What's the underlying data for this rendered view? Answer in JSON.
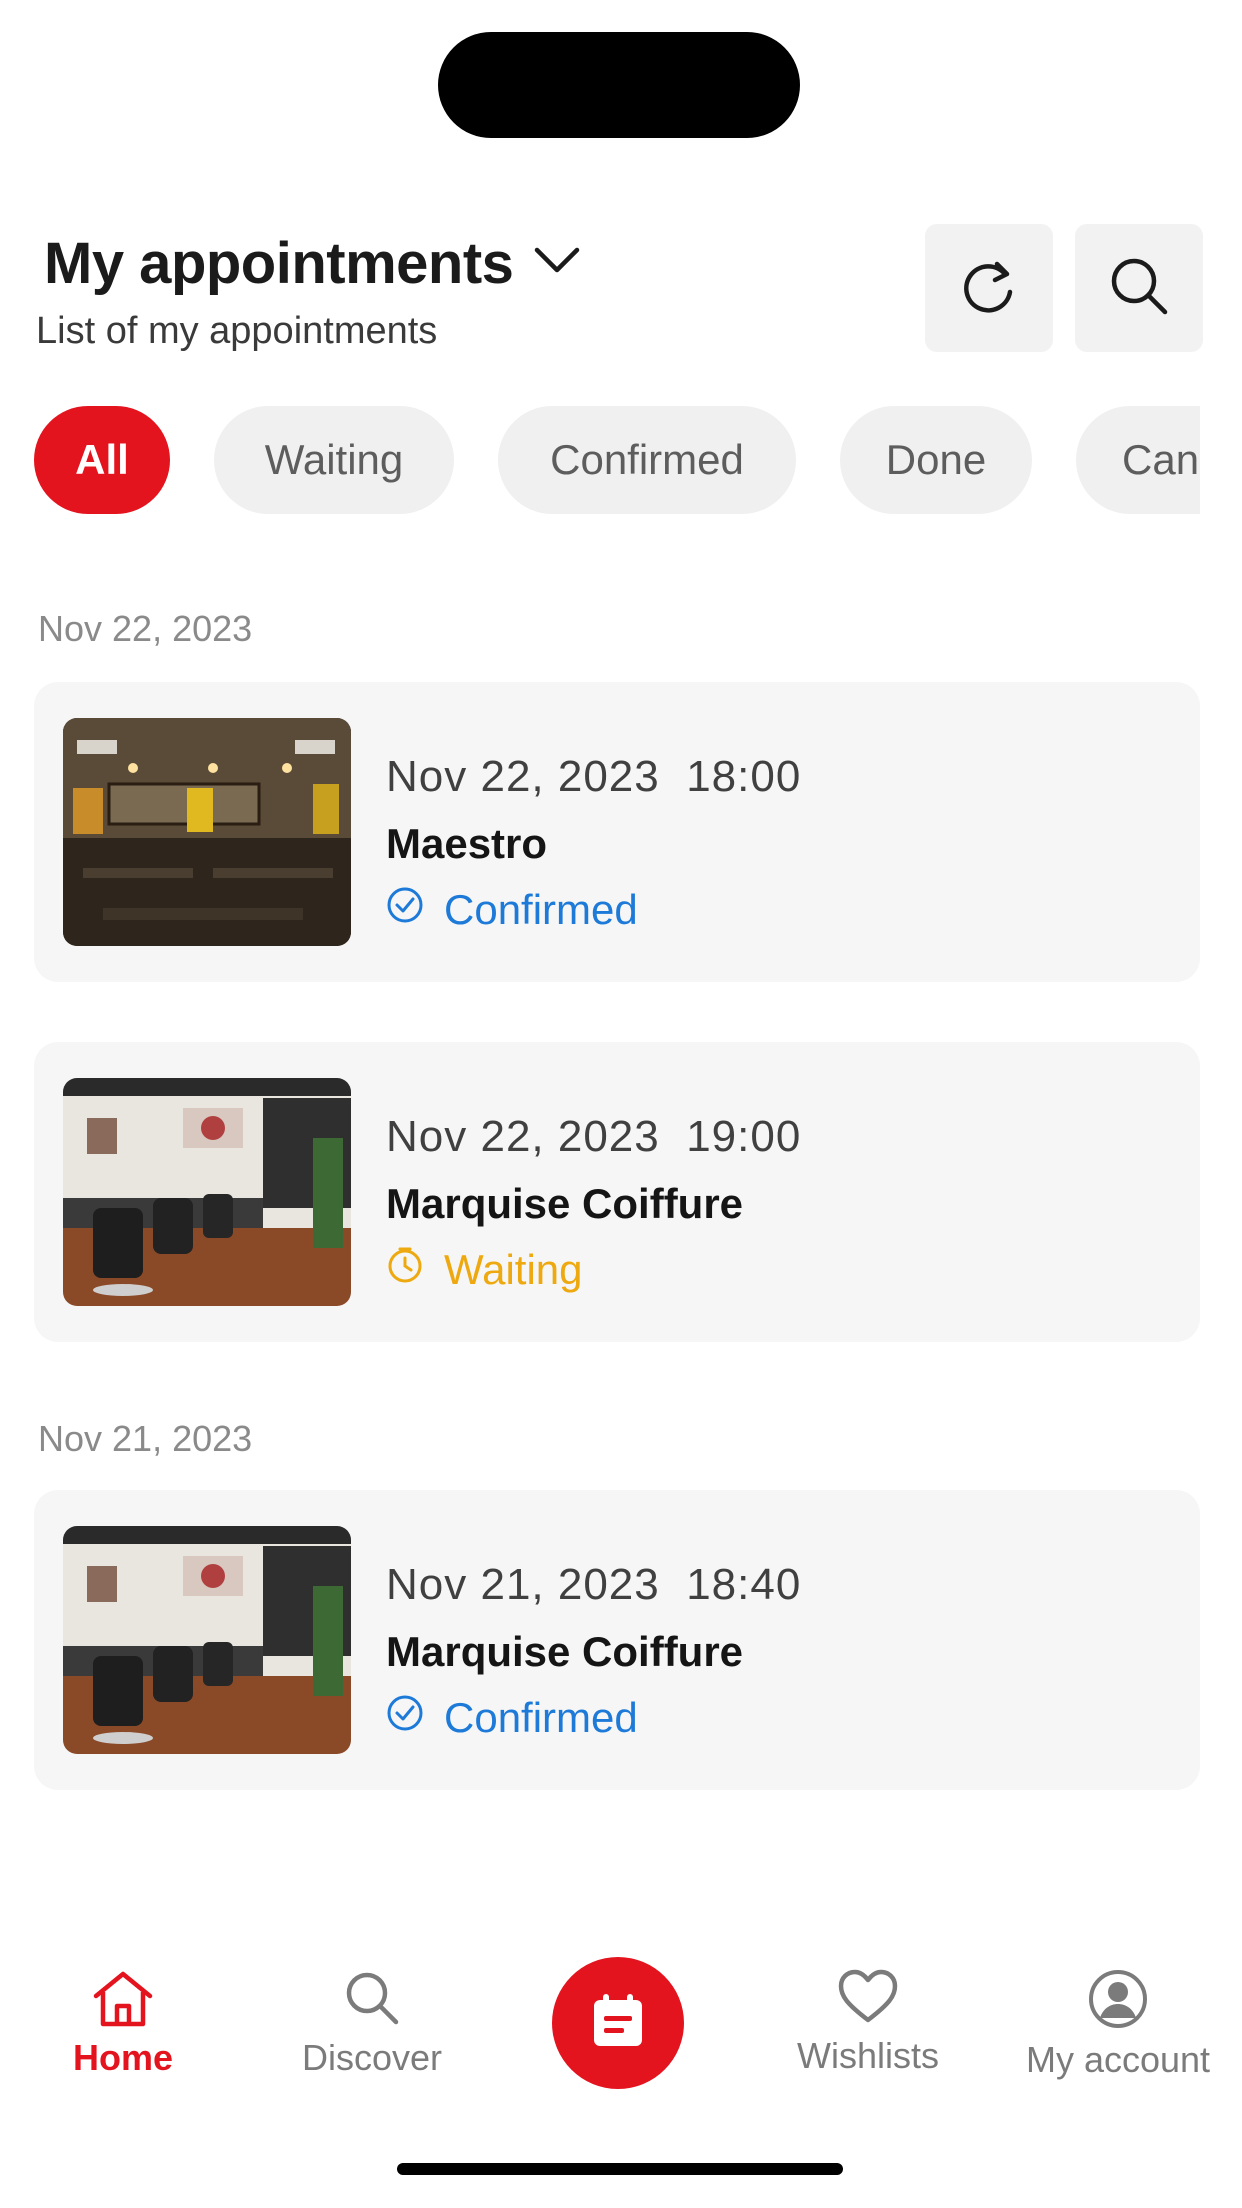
{
  "header": {
    "title": "My appointments",
    "subtitle": "List of my appointments",
    "buttons": [
      {
        "icon": "refresh-icon"
      },
      {
        "icon": "search-icon"
      }
    ]
  },
  "filters": [
    "All",
    "Waiting",
    "Confirmed",
    "Done",
    "Cancelled"
  ],
  "active_filter": "All",
  "groups": [
    {
      "date": "Nov 22, 2023",
      "appointments": [
        {
          "date": "Nov 22, 2023",
          "time": "18:00",
          "name": "Maestro",
          "status": "Confirmed",
          "status_icon": "check-circle-icon",
          "image": "restaurant-interior-photo"
        },
        {
          "date": "Nov 22, 2023",
          "time": "19:00",
          "name": "Marquise Coiffure",
          "status": "Waiting",
          "status_icon": "clock-icon",
          "image": "barbershop-interior-photo"
        }
      ]
    },
    {
      "date": "Nov 21, 2023",
      "appointments": [
        {
          "date": "Nov 21, 2023",
          "time": "18:40",
          "name": "Marquise Coiffure",
          "status": "Confirmed",
          "status_icon": "check-circle-icon",
          "image": "barbershop-interior-photo"
        }
      ]
    }
  ],
  "tabbar": {
    "home": "Home",
    "discover": "Discover",
    "center_icon": "calendar-icon",
    "wishlists": "Wishlists",
    "account": "My account"
  },
  "colors": {
    "accent": "#e4141f",
    "confirmed": "#1d7ad8",
    "waiting": "#eda90f"
  }
}
